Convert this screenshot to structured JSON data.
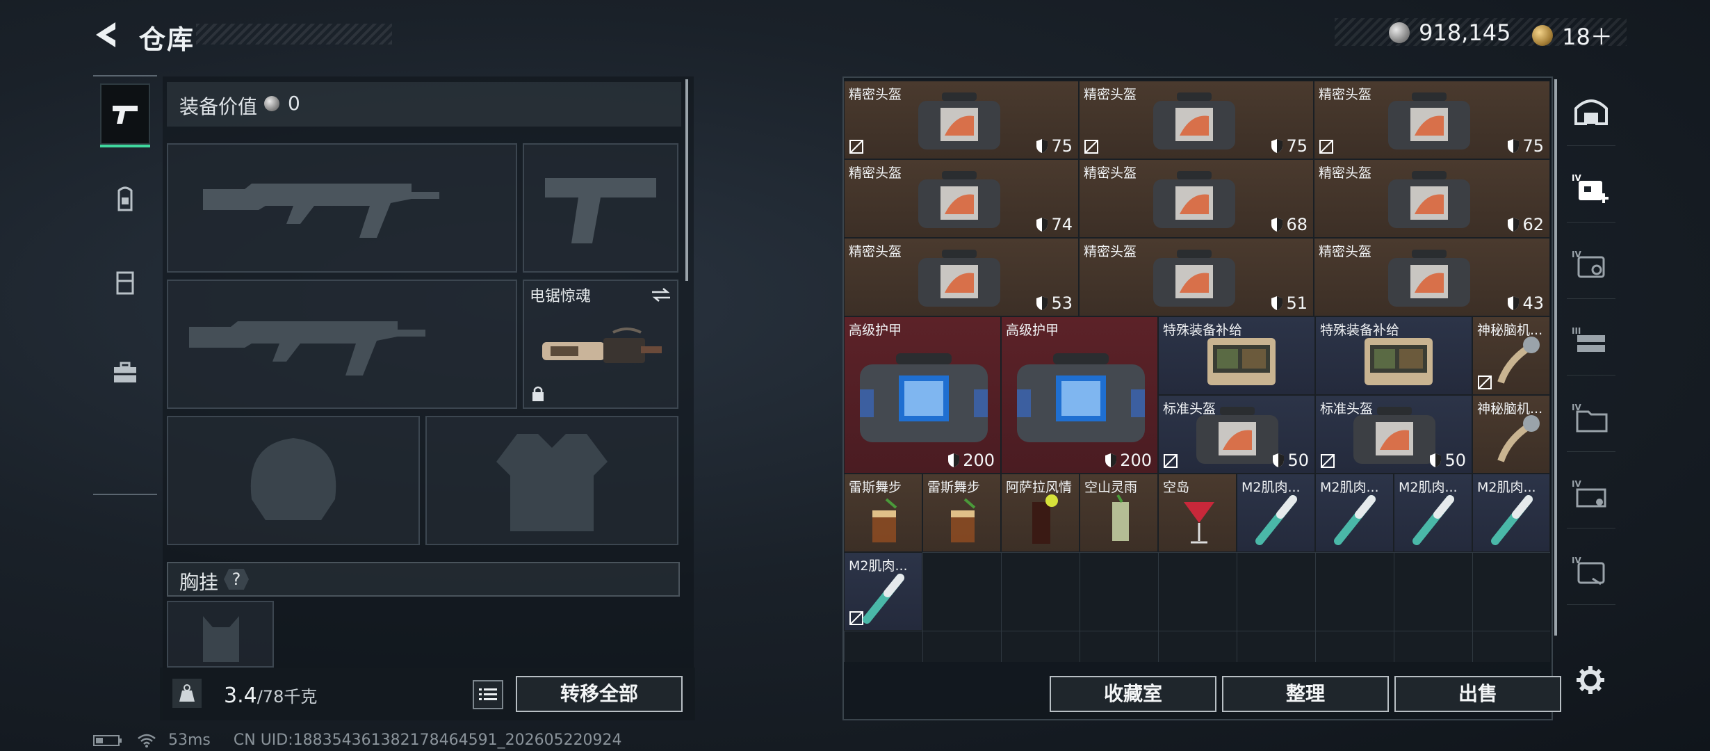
{
  "header": {
    "title": "仓库",
    "currency": [
      {
        "icon": "silver-coin-icon",
        "value": "918,145"
      },
      {
        "icon": "gold-coin-icon",
        "value": "18＋"
      }
    ]
  },
  "left_tabs": [
    "pistol-icon",
    "backpack-icon",
    "rig-icon",
    "toolbox-icon"
  ],
  "equipment": {
    "value_label": "装备价值",
    "value": "0",
    "melee_name": "电锯惊魂",
    "chest_label": "胸挂",
    "chest_help": "?"
  },
  "bottom_left": {
    "weight": "3.4",
    "weight_max": "/78千克",
    "transfer_label": "转移全部"
  },
  "items": [
    {
      "name": "精密头盔",
      "dur": "75"
    },
    {
      "name": "精密头盔",
      "dur": "75"
    },
    {
      "name": "精密头盔",
      "dur": "75"
    },
    {
      "name": "精密头盔",
      "dur": "74"
    },
    {
      "name": "精密头盔",
      "dur": "68"
    },
    {
      "name": "精密头盔",
      "dur": "62"
    },
    {
      "name": "精密头盔",
      "dur": "53"
    },
    {
      "name": "精密头盔",
      "dur": "51"
    },
    {
      "name": "精密头盔",
      "dur": "43"
    },
    {
      "name": "高级护甲",
      "dur": "200"
    },
    {
      "name": "高级护甲",
      "dur": "200"
    },
    {
      "name": "特殊装备补给",
      "dur": ""
    },
    {
      "name": "特殊装备补给",
      "dur": ""
    },
    {
      "name": "神秘脑机...",
      "dur": ""
    },
    {
      "name": "标准头盔",
      "dur": "50"
    },
    {
      "name": "标准头盔",
      "dur": "50"
    },
    {
      "name": "神秘脑机...",
      "dur": ""
    },
    {
      "name": "雷斯舞步",
      "dur": ""
    },
    {
      "name": "雷斯舞步",
      "dur": ""
    },
    {
      "name": "阿萨拉风情",
      "dur": ""
    },
    {
      "name": "空山灵雨",
      "dur": ""
    },
    {
      "name": "空岛",
      "dur": ""
    },
    {
      "name": "M2肌肉...",
      "dur": ""
    },
    {
      "name": "M2肌肉...",
      "dur": ""
    },
    {
      "name": "M2肌肉...",
      "dur": ""
    },
    {
      "name": "M2肌肉...",
      "dur": ""
    },
    {
      "name": "M2肌肉...",
      "dur": ""
    }
  ],
  "actions": {
    "collection": "收藏室",
    "organize": "整理",
    "sell": "出售"
  },
  "right_tabs": [
    "vault-icon",
    "IV",
    "IV",
    "III",
    "IV",
    "IV",
    "IV"
  ],
  "status": {
    "ping": "53ms",
    "uid": "CN UID:18835436138217846459​1_202605220924"
  }
}
